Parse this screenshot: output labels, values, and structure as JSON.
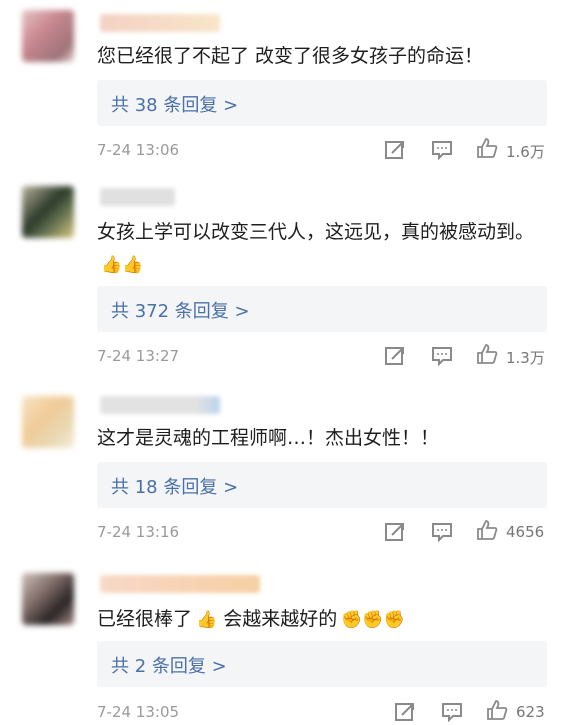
{
  "comments": [
    {
      "text": "您已经很了不起了 改变了很多女孩子的命运！",
      "emoji": "",
      "replies_label": "共 38 条回复 >",
      "time": "7-24 13:06",
      "likes": "1.6万",
      "avatar_colors": [
        "#c9878f",
        "#e6c4c5",
        "#b6a0a6"
      ],
      "username_color": "#f3c8b8"
    },
    {
      "text": "女孩上学可以改变三代人，这远见，真的被感动到。",
      "emoji": "👍👍",
      "replies_label": "共 372 条回复 >",
      "time": "7-24 13:27",
      "likes": "1.3万",
      "avatar_colors": [
        "#2d3b2a",
        "#b8b29c",
        "#d8c97d"
      ],
      "username_color": "#d7d7d7"
    },
    {
      "text": "这才是灵魂的工程师啊…！杰出女性！！",
      "emoji": "",
      "replies_label": "共 18 条回复 >",
      "time": "7-24 13:16",
      "likes": "4656",
      "avatar_colors": [
        "#f1cb99",
        "#e9d7b0",
        "#f6e4c4"
      ],
      "username_color": "#cfd9e6"
    },
    {
      "text": "已经很棒了",
      "text2": "会越来越好的",
      "emoji": "👍",
      "emoji2": "✊✊✊",
      "replies_label": "共 2 条回复 >",
      "time": "7-24 13:05",
      "likes": "623",
      "avatar_colors": [
        "#7c6a66",
        "#cfc2bc",
        "#2b2526"
      ],
      "username_color": "#f7d3b8"
    }
  ],
  "icons": {
    "share": "share-icon",
    "comment": "comment-icon",
    "like": "like-icon"
  }
}
